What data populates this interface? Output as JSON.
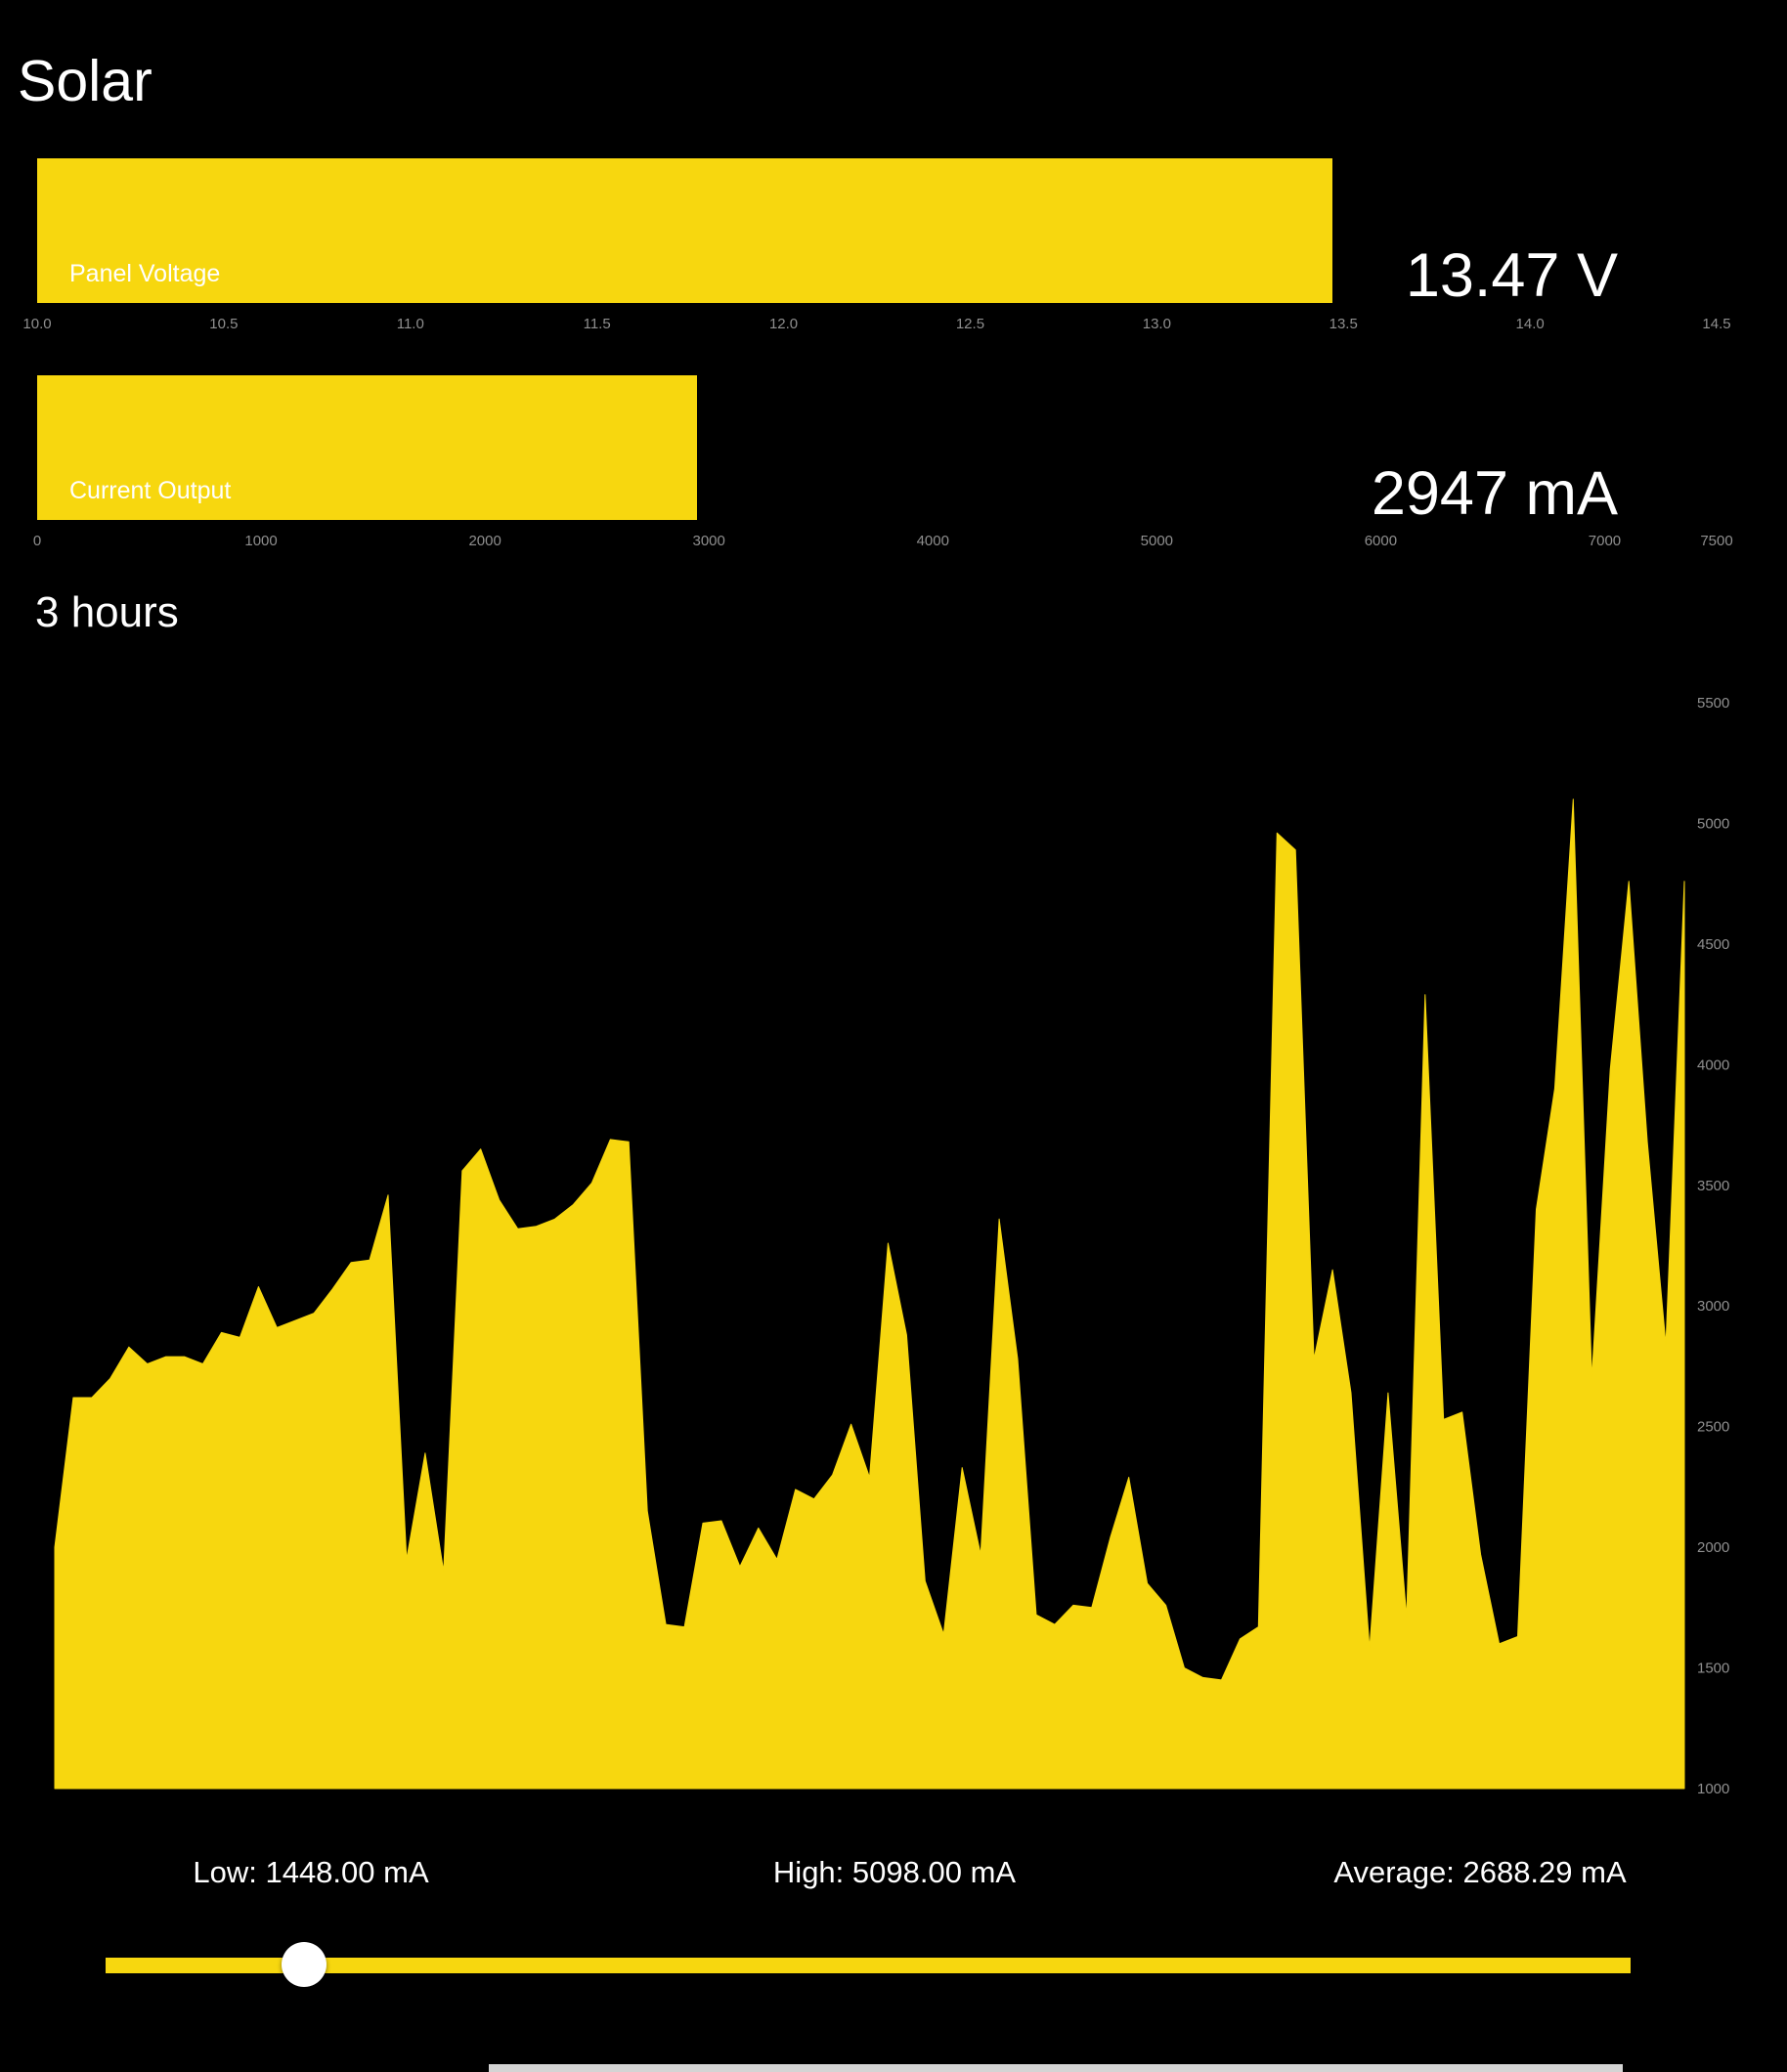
{
  "page": {
    "title": "Solar",
    "accent_color": "#f7d70f",
    "background_color": "#000000",
    "tick_color": "#8f8f8f"
  },
  "gauges": [
    {
      "name": "panel-voltage",
      "label": "Panel Voltage",
      "readout": "13.47 V",
      "value": 13.47,
      "range": [
        10.0,
        14.5
      ],
      "ticks": [
        "10.0",
        "10.5",
        "11.0",
        "11.5",
        "12.0",
        "12.5",
        "13.0",
        "13.5",
        "14.0",
        "14.5"
      ]
    },
    {
      "name": "current-output",
      "label": "Current Output",
      "readout": "2947 mA",
      "value": 2947,
      "range": [
        0,
        7500
      ],
      "ticks": [
        "0",
        "1000",
        "2000",
        "3000",
        "4000",
        "5000",
        "6000",
        "7000",
        "7500"
      ]
    }
  ],
  "history": {
    "title": "3 hours",
    "stats": {
      "low": "Low: 1448.00 mA",
      "high": "High: 5098.00 mA",
      "average": "Average: 2688.29 mA"
    },
    "slider_position": 0.13
  },
  "chart_data": {
    "type": "area",
    "title": "",
    "xlabel": "",
    "ylabel": "",
    "ylim": [
      1000,
      5500
    ],
    "yticks": [
      1000,
      1500,
      2000,
      2500,
      3000,
      3500,
      4000,
      4500,
      5000,
      5500
    ],
    "grid": false,
    "legend": "none",
    "color": "#f7d70f",
    "values": [
      2000,
      2620,
      2620,
      2700,
      2830,
      2760,
      2790,
      2790,
      2760,
      2890,
      2870,
      3080,
      2910,
      2940,
      2970,
      3070,
      3180,
      3190,
      3460,
      1950,
      2390,
      1900,
      3560,
      3650,
      3440,
      3320,
      3330,
      3360,
      3420,
      3510,
      3690,
      3680,
      2150,
      1680,
      1670,
      2100,
      2110,
      1920,
      2080,
      1950,
      2240,
      2200,
      2300,
      2510,
      2290,
      3260,
      2880,
      1860,
      1640,
      2330,
      1970,
      3360,
      2780,
      1720,
      1680,
      1760,
      1750,
      2040,
      2290,
      1850,
      1760,
      1500,
      1460,
      1450,
      1620,
      1670,
      4960,
      4890,
      2780,
      3150,
      2640,
      1580,
      2640,
      1710,
      4290,
      2530,
      2560,
      1970,
      1600,
      1630,
      3400,
      3900,
      5100,
      2700,
      3980,
      4760,
      3680,
      2840,
      4760
    ]
  }
}
